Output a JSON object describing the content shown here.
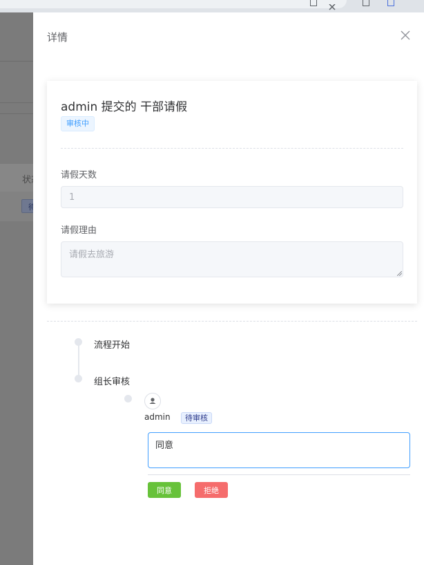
{
  "drawer": {
    "title": "详情"
  },
  "background": {
    "column_header": "状态",
    "row_tag": "待"
  },
  "card": {
    "title": "admin 提交的 干部请假",
    "status": "审核中",
    "fields": [
      {
        "label": "请假天数",
        "value": "1"
      },
      {
        "label": "请假理由",
        "value": "请假去旅游"
      }
    ]
  },
  "timeline": {
    "steps": [
      {
        "label": "流程开始"
      },
      {
        "label": "组长审核"
      }
    ],
    "approver": {
      "name": "admin",
      "status": "待审核"
    }
  },
  "approval": {
    "comment": "同意",
    "agree_label": "同意",
    "reject_label": "拒绝"
  },
  "colors": {
    "agree": "#67c23a",
    "reject": "#f56c6c",
    "primary": "#409eff"
  },
  "icons": {
    "close": "close-icon",
    "avatar": "user-icon"
  }
}
